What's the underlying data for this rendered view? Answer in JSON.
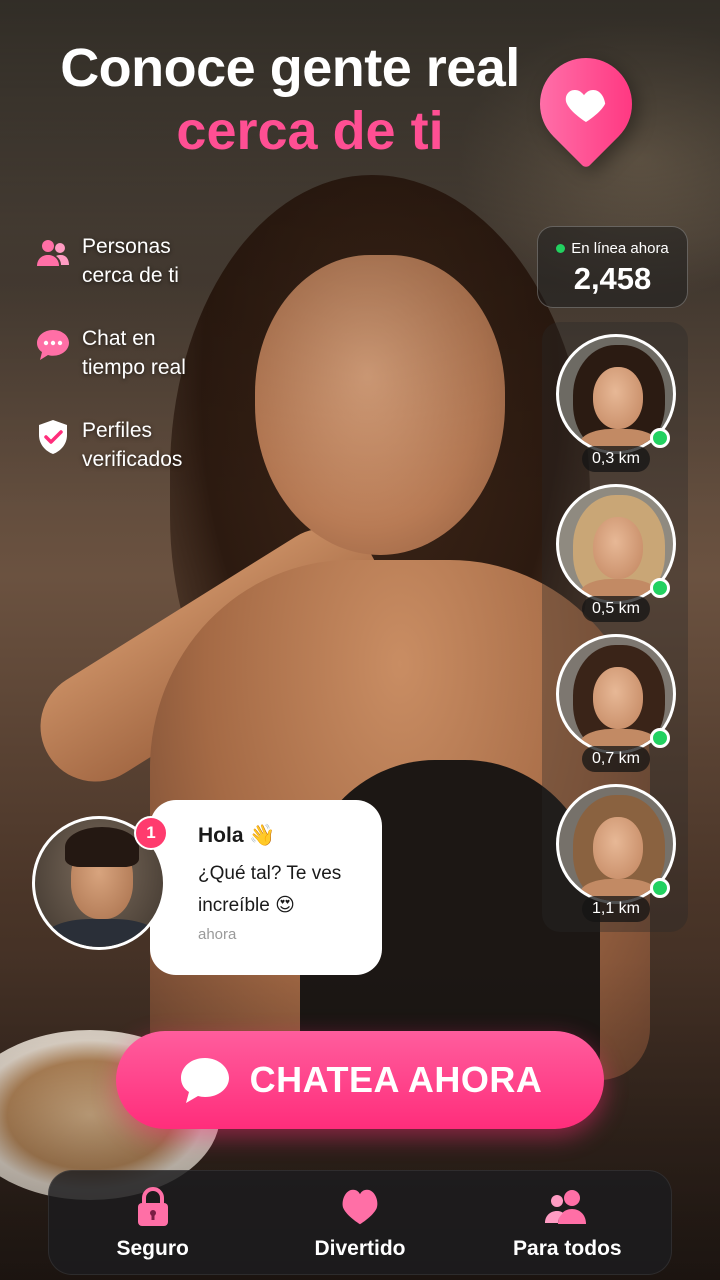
{
  "headline": {
    "line1": "Conoce gente real",
    "line2": "cerca de ti"
  },
  "colors": {
    "accent": "#ff2d7b",
    "online": "#22d160"
  },
  "features": [
    {
      "icon": "people-icon",
      "text": "Personas cerca de ti"
    },
    {
      "icon": "chat-bubble-icon",
      "text": "Chat en tiempo real"
    },
    {
      "icon": "shield-check-icon",
      "text": "Perfiles verificados"
    }
  ],
  "online": {
    "label": "En línea ahora",
    "count": "2,458"
  },
  "profiles": [
    {
      "distance": "0,3 km",
      "online": true
    },
    {
      "distance": "0,5 km",
      "online": true
    },
    {
      "distance": "0,7 km",
      "online": true
    },
    {
      "distance": "1,1 km",
      "online": true
    }
  ],
  "chat": {
    "unread_count": "1",
    "greeting": "Hola 👋",
    "message": "¿Qué tal? Te ves increíble 😍",
    "time": "ahora"
  },
  "cta": {
    "label": "CHATEA AHORA",
    "icon": "chat-bubble-icon"
  },
  "nav": [
    {
      "icon": "lock-icon",
      "label": "Seguro"
    },
    {
      "icon": "heart-icon",
      "label": "Divertido"
    },
    {
      "icon": "people-icon",
      "label": "Para todos"
    }
  ]
}
